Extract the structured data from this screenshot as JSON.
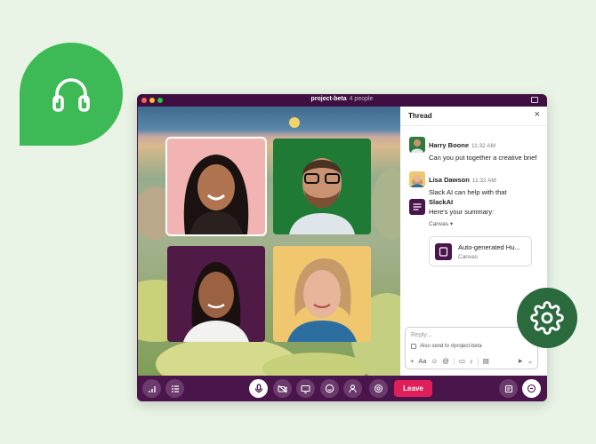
{
  "badges": {
    "left_icon": "headphones-icon",
    "right_icon": "gear-icon",
    "left_color": "#3dba55",
    "right_color": "#2a6a3c"
  },
  "window": {
    "title": "project-beta",
    "people": "4 people"
  },
  "participants": [
    {
      "name": "participant-1",
      "active": true
    },
    {
      "name": "participant-2",
      "active": false
    },
    {
      "name": "participant-3",
      "active": false
    },
    {
      "name": "participant-4",
      "active": false
    }
  ],
  "thread": {
    "title": "Thread",
    "messages": [
      {
        "sender": "Harry Boone",
        "time": "11:32 AM",
        "text": "Can you put together a creative brief"
      },
      {
        "sender": "Lisa Dawson",
        "time": "11:32 AM",
        "text": "Slack AI can help with that"
      },
      {
        "sender": "SlackAI",
        "time": "",
        "text": "Here's your summary:",
        "canvas_toggle": "Canvas",
        "canvas_name": "Auto-generated Hu...",
        "canvas_type": "Canvas"
      }
    ],
    "composer": {
      "placeholder": "Reply...",
      "also_send": "Also send to #project-beta",
      "format_label": "Aa"
    }
  },
  "callbar": {
    "leave_label": "Leave",
    "leave_color": "#e01e5a"
  }
}
